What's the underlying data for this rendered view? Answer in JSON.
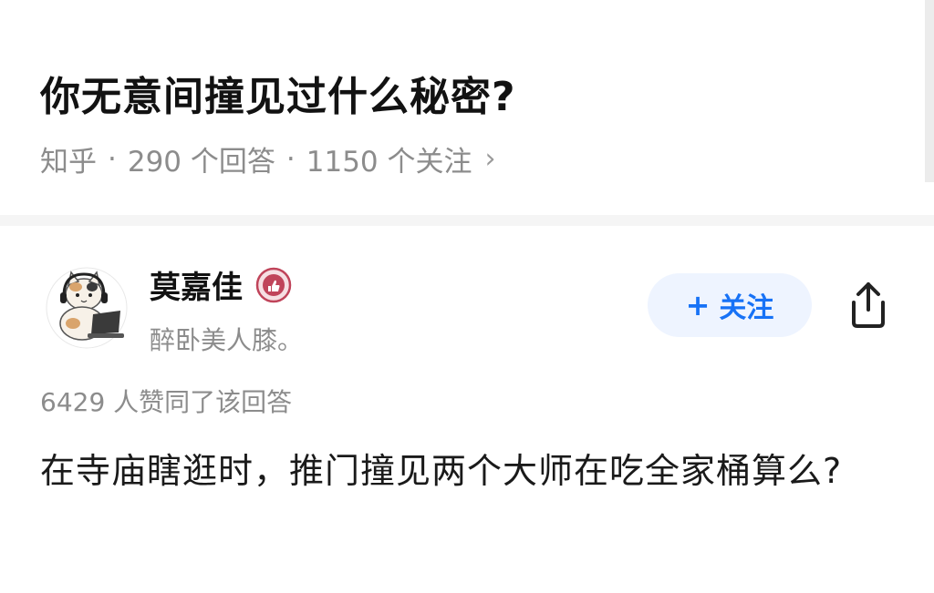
{
  "question": {
    "title": "你无意间撞见过什么秘密?",
    "source": "知乎",
    "separator": "·",
    "answers_count": "290 个回答",
    "followers_count": "1150 个关注",
    "chevron": "›"
  },
  "answer": {
    "author": {
      "name": "莫嘉佳",
      "bio": "醉卧美人膝。",
      "badge_icon": "badge-icon",
      "avatar_icon": "cat-with-laptop-avatar"
    },
    "follow_button": {
      "plus": "+",
      "label": "关注"
    },
    "share_icon": "share-icon",
    "upvote_text": "6429 人赞同了该回答",
    "body": "在寺庙瞎逛时，推门撞见两个大师在吃全家桶算么?"
  },
  "colors": {
    "accent": "#1772f6",
    "follow_bg": "#eef4ff",
    "muted_text": "#8c8c8c",
    "badge": "#c0445a"
  }
}
